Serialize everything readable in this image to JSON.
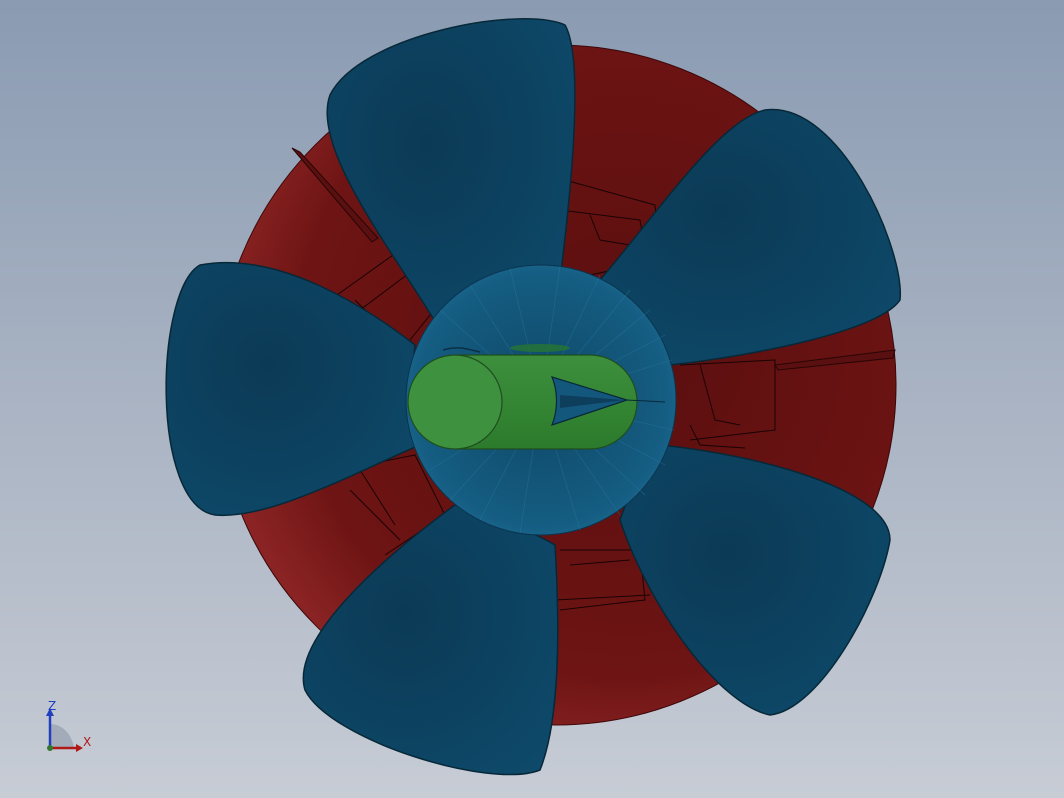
{
  "scene": {
    "model": "propeller-assembly",
    "colors": {
      "duct": "#6e1414",
      "duct_rim": "#8a2323",
      "blade": "#0e4766",
      "blade_edge": "#0a2f45",
      "hub": "#1a5a7a",
      "shaft": "#3a8a3a",
      "shaft_edge": "#1f4d1f",
      "background_top": "#8a9bb2",
      "background_bottom": "#c7ccd5"
    }
  },
  "triad": {
    "z_label": "Z",
    "x_label": "X",
    "z_color": "#1f3fbf",
    "x_color": "#b01818"
  }
}
